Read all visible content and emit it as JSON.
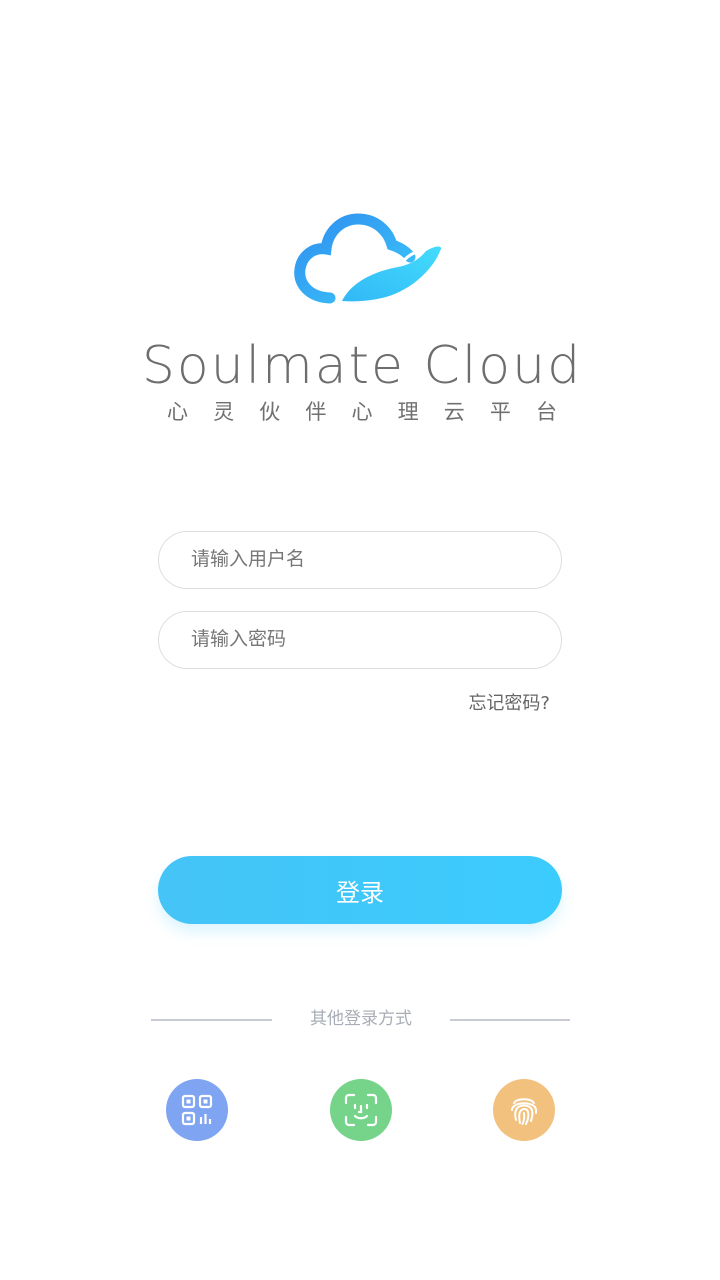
{
  "brand": {
    "name": "Soulmate Cloud",
    "subtitle_chars": [
      "心",
      "灵",
      "伙",
      "伴",
      "心",
      "理",
      "云",
      "平",
      "台"
    ]
  },
  "form": {
    "username_placeholder": "请输入用户名",
    "password_placeholder": "请输入密码",
    "forgot_label": "忘记密码?",
    "login_label": "登录"
  },
  "alt_login": {
    "divider_label": "其他登录方式",
    "methods": [
      {
        "name": "qr-code",
        "icon": "qr-code-icon",
        "color": "#7fa4f2"
      },
      {
        "name": "face-recognition",
        "icon": "face-scan-icon",
        "color": "#76d48a"
      },
      {
        "name": "fingerprint",
        "icon": "fingerprint-icon",
        "color": "#f3c17e"
      }
    ]
  },
  "colors": {
    "accent": "#3fc8fb",
    "logo_dark": "#2f93f0",
    "logo_light": "#3cd2fb"
  }
}
